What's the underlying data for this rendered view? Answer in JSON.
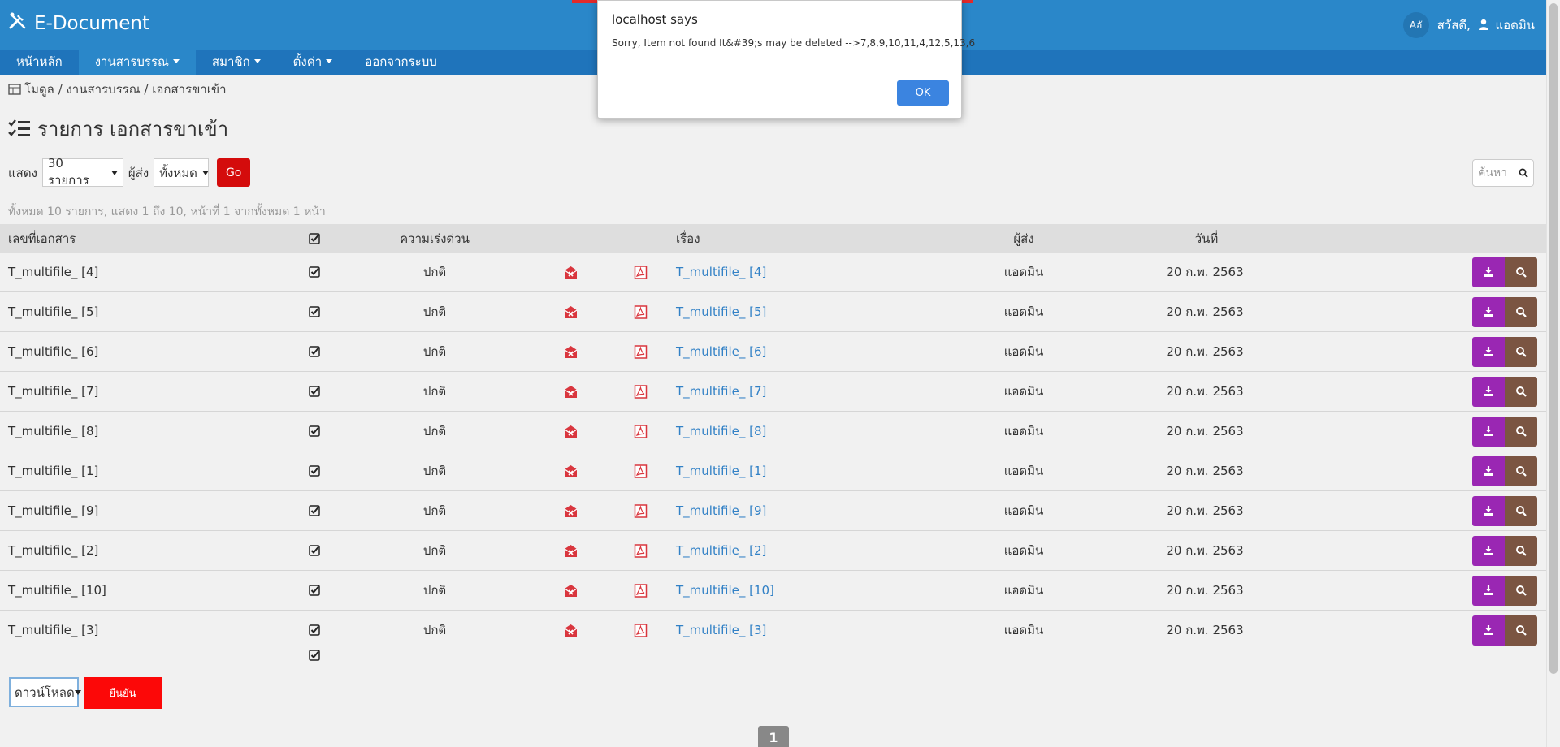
{
  "header": {
    "app_title": "E-Document",
    "lang_label": "Aอั",
    "greeting": "สวัสดี,",
    "user_name": "แอดมิน"
  },
  "menu": [
    {
      "label": "หน้าหลัก",
      "dropdown": false,
      "active": false
    },
    {
      "label": "งานสารบรรณ",
      "dropdown": true,
      "active": true
    },
    {
      "label": "สมาชิก",
      "dropdown": true,
      "active": false
    },
    {
      "label": "ตั้งค่า",
      "dropdown": true,
      "active": false
    },
    {
      "label": "ออกจากระบบ",
      "dropdown": false,
      "active": false
    }
  ],
  "breadcrumb": {
    "text": "โมดูล / งานสารบรรณ / เอกสารขาเข้า"
  },
  "page": {
    "title": "รายการ เอกสารขาเข้า"
  },
  "toolbar": {
    "show_label": "แสดง",
    "per_page_value": "30 รายการ",
    "sender_label": "ผู้ส่ง",
    "sender_value": "ทั้งหมด",
    "go_label": "Go",
    "search_placeholder": "ค้นหา"
  },
  "summary": "ทั้งหมด 10 รายการ, แสดง 1 ถึง 10, หน้าที่ 1 จากทั้งหมด 1 หน้า",
  "table": {
    "headers": {
      "doc_no": "เลขที่เอกสาร",
      "urgency": "ความเร่งด่วน",
      "subject": "เรื่อง",
      "sender": "ผู้ส่ง",
      "date": "วันที่"
    },
    "rows": [
      {
        "doc_no": "T_multifile_ [4]",
        "urgency": "ปกติ",
        "subject": "T_multifile_ [4]",
        "sender": "แอดมิน",
        "date": "20 ก.พ. 2563"
      },
      {
        "doc_no": "T_multifile_ [5]",
        "urgency": "ปกติ",
        "subject": "T_multifile_ [5]",
        "sender": "แอดมิน",
        "date": "20 ก.พ. 2563"
      },
      {
        "doc_no": "T_multifile_ [6]",
        "urgency": "ปกติ",
        "subject": "T_multifile_ [6]",
        "sender": "แอดมิน",
        "date": "20 ก.พ. 2563"
      },
      {
        "doc_no": "T_multifile_ [7]",
        "urgency": "ปกติ",
        "subject": "T_multifile_ [7]",
        "sender": "แอดมิน",
        "date": "20 ก.พ. 2563"
      },
      {
        "doc_no": "T_multifile_ [8]",
        "urgency": "ปกติ",
        "subject": "T_multifile_ [8]",
        "sender": "แอดมิน",
        "date": "20 ก.พ. 2563"
      },
      {
        "doc_no": "T_multifile_ [1]",
        "urgency": "ปกติ",
        "subject": "T_multifile_ [1]",
        "sender": "แอดมิน",
        "date": "20 ก.พ. 2563"
      },
      {
        "doc_no": "T_multifile_ [9]",
        "urgency": "ปกติ",
        "subject": "T_multifile_ [9]",
        "sender": "แอดมิน",
        "date": "20 ก.พ. 2563"
      },
      {
        "doc_no": "T_multifile_ [2]",
        "urgency": "ปกติ",
        "subject": "T_multifile_ [2]",
        "sender": "แอดมิน",
        "date": "20 ก.พ. 2563"
      },
      {
        "doc_no": "T_multifile_ [10]",
        "urgency": "ปกติ",
        "subject": "T_multifile_ [10]",
        "sender": "แอดมิน",
        "date": "20 ก.พ. 2563"
      },
      {
        "doc_no": "T_multifile_ [3]",
        "urgency": "ปกติ",
        "subject": "T_multifile_ [3]",
        "sender": "แอดมิน",
        "date": "20 ก.พ. 2563"
      }
    ]
  },
  "bulk": {
    "action_value": "ดาวน์โหลด",
    "submit_label": "ยืนยัน"
  },
  "pagination": {
    "current": "1"
  },
  "dialog": {
    "title": "localhost says",
    "message": "Sorry, Item not found It&#39;s may be deleted -->7,8,9,10,11,4,12,5,13,6",
    "ok_label": "OK"
  },
  "icons": {
    "brand": "tools-icon",
    "breadcrumb": "module-icon",
    "title": "list-check-icon",
    "mail": "envelope-x-icon",
    "pdf": "pdf-icon",
    "download": "download-icon",
    "view": "search-icon"
  },
  "colors": {
    "header": "#2a87c9",
    "menubar": "#1f74bb",
    "go_button": "#d40c0c",
    "download_button": "#9a27b3",
    "view_button": "#7b5542",
    "mail_icon": "#d9363e",
    "link": "#3281c6",
    "ok_button": "#3b84e0"
  }
}
